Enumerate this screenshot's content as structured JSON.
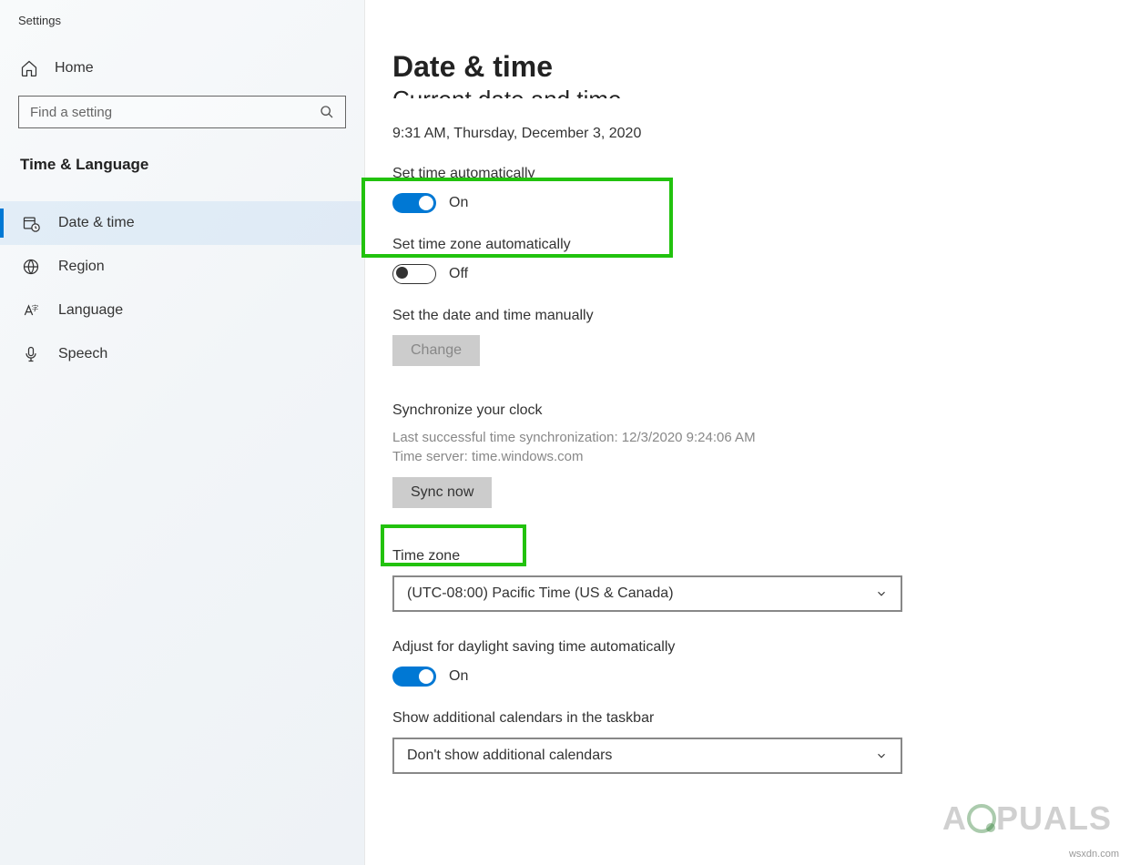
{
  "app_title": "Settings",
  "sidebar": {
    "home": "Home",
    "search_placeholder": "Find a setting",
    "category": "Time & Language",
    "items": [
      {
        "label": "Date & time"
      },
      {
        "label": "Region"
      },
      {
        "label": "Language"
      },
      {
        "label": "Speech"
      }
    ]
  },
  "main": {
    "title": "Date & time",
    "current_datetime": "9:31 AM, Thursday, December 3, 2020",
    "set_time_auto": {
      "label": "Set time automatically",
      "state": "On"
    },
    "set_timezone_auto": {
      "label": "Set time zone automatically",
      "state": "Off"
    },
    "set_manually": {
      "label": "Set the date and time manually",
      "button": "Change"
    },
    "sync": {
      "heading": "Synchronize your clock",
      "last_sync": "Last successful time synchronization: 12/3/2020 9:24:06 AM",
      "server": "Time server: time.windows.com",
      "button": "Sync now"
    },
    "timezone": {
      "label": "Time zone",
      "value": "(UTC-08:00) Pacific Time (US & Canada)"
    },
    "dst": {
      "label": "Adjust for daylight saving time automatically",
      "state": "On"
    },
    "calendars": {
      "label": "Show additional calendars in the taskbar",
      "value": "Don't show additional calendars"
    }
  },
  "watermark": "A PUALS",
  "source": "wsxdn.com"
}
